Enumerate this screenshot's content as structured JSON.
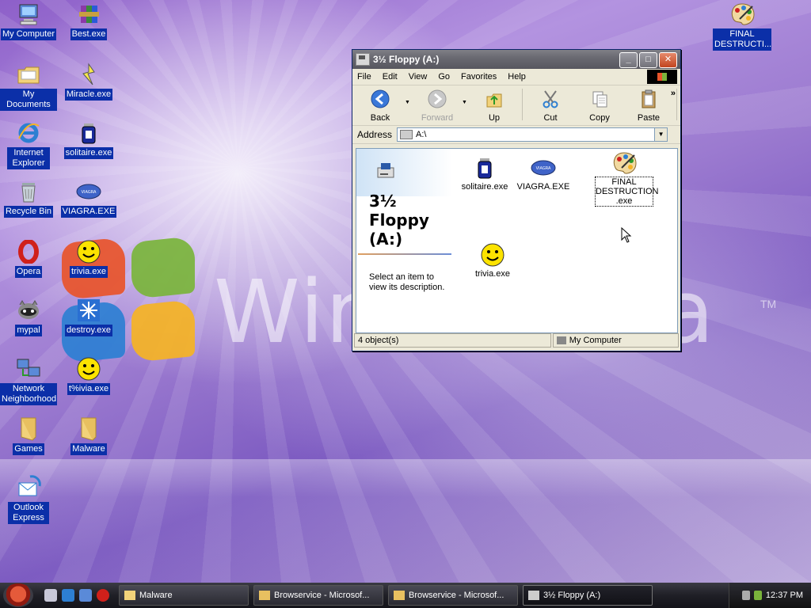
{
  "desktop": {
    "icons": [
      {
        "label": "My Computer",
        "icon": "computer-icon"
      },
      {
        "label": "Best.exe",
        "icon": "winrar-icon"
      },
      {
        "label": "My Documents",
        "icon": "folder-icon"
      },
      {
        "label": "Miracle.exe",
        "icon": "miracle-icon"
      },
      {
        "label": "Internet Explorer",
        "icon": "ie-icon"
      },
      {
        "label": "solitaire.exe",
        "icon": "jar-icon"
      },
      {
        "label": "Recycle Bin",
        "icon": "recycle-bin-icon"
      },
      {
        "label": "VIAGRA.EXE",
        "icon": "pill-icon"
      },
      {
        "label": "Opera",
        "icon": "opera-icon"
      },
      {
        "label": "trivia.exe",
        "icon": "smiley-icon"
      },
      {
        "label": "mypal",
        "icon": "raccoon-icon"
      },
      {
        "label": "destroy.exe",
        "icon": "snowflake-icon"
      },
      {
        "label": "Network Neighborhood",
        "icon": "network-icon"
      },
      {
        "label": "t%ivia.exe",
        "icon": "smiley-icon"
      },
      {
        "label": "Games",
        "icon": "folder-icon"
      },
      {
        "label": "Malware",
        "icon": "folder-icon"
      },
      {
        "label": "Outlook Express",
        "icon": "outlook-icon"
      },
      {
        "label": "FINAL DESTRUCTI...",
        "icon": "paint-palette-icon"
      }
    ],
    "wallpaper_text": "Win",
    "wallpaper_text2": "na",
    "wallpaper_tm": "TM"
  },
  "window": {
    "title": "3½ Floppy (A:)",
    "menu": [
      "File",
      "Edit",
      "View",
      "Go",
      "Favorites",
      "Help"
    ],
    "toolbar": {
      "back": "Back",
      "forward": "Forward",
      "up": "Up",
      "cut": "Cut",
      "copy": "Copy",
      "paste": "Paste"
    },
    "address_label": "Address",
    "address_value": "A:\\",
    "left_pane": {
      "title_line1": "3½",
      "title_line2": "Floppy",
      "title_line3": "(A:)",
      "description": "Select an item to view its description."
    },
    "files": [
      {
        "label": "solitaire.exe",
        "icon": "jar-icon"
      },
      {
        "label": "VIAGRA.EXE",
        "icon": "pill-icon"
      },
      {
        "label": "FINAL DESTRUCTION .exe",
        "icon": "paint-palette-icon"
      },
      {
        "label": "trivia.exe",
        "icon": "smiley-icon"
      }
    ],
    "status_objects": "4 object(s)",
    "status_zone": "My Computer"
  },
  "taskbar": {
    "tasks": [
      "Malware",
      "Browservice - Microsof...",
      "Browservice - Microsof...",
      "3½ Floppy (A:)"
    ],
    "clock": "12:37 PM"
  },
  "colors": {
    "selection": "#0b2fa8",
    "title_bar": "#6a6a72",
    "taskbar": "#1f1f26"
  }
}
